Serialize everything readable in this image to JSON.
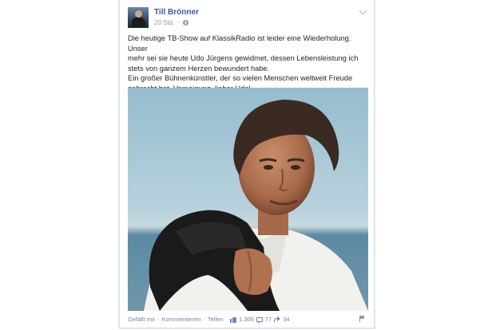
{
  "post": {
    "author": "Till Brönner",
    "time": "20 Std.",
    "text_lines": [
      "Die heutige TB-Show auf KlassikRadio ist leider eine Wiederholung. Unser",
      "mehr sei sie heute Udo Jürgens gewidmet, dessen Lebensleistung ich",
      "stets von ganzem Herzen bewundert habe.",
      "Ein großer Bühnenkünstler, der so vielen Menschen weltweit Freude",
      "gebracht hat. Verneigung, lieber Udo!"
    ]
  },
  "actions": {
    "like": "Gefällt mir",
    "comment": "Kommentieren",
    "share": "Teilen",
    "like_count": "1.306",
    "comment_count": "77",
    "share_count": "34"
  },
  "icons": {
    "audience": "globe-icon",
    "menu": "chevron-down-icon",
    "likes": "thumb-up-icon",
    "comments": "comment-icon",
    "shares": "share-icon",
    "report": "flag-icon"
  },
  "colors": {
    "link": "#3b5998",
    "meta": "#9197a3",
    "action": "#6d84b4"
  }
}
